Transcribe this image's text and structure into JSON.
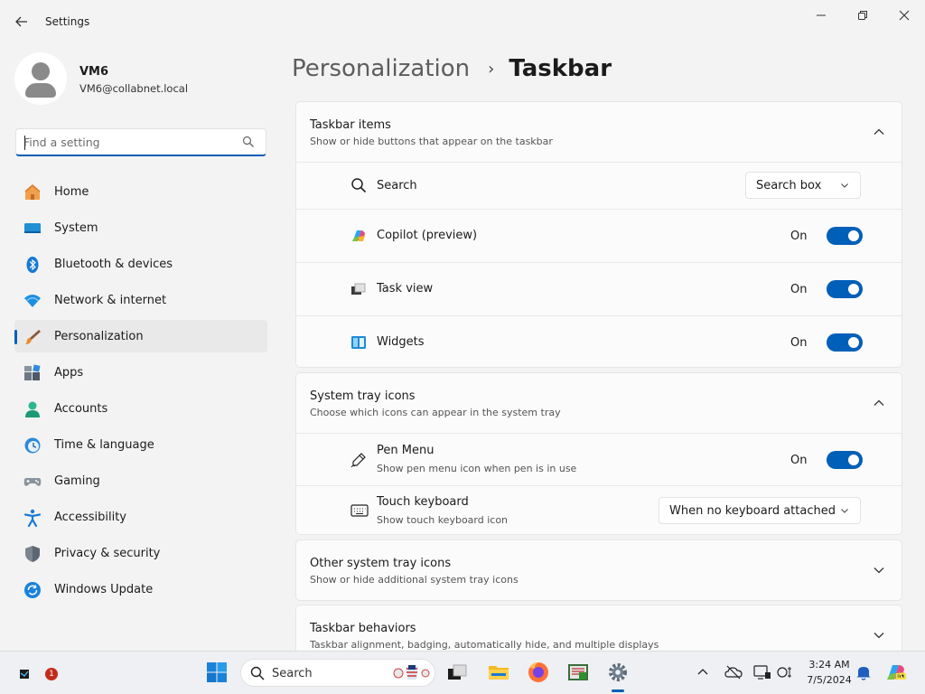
{
  "window": {
    "title": "Settings",
    "back_icon": "back-arrow-icon",
    "controls": [
      "minimize-icon",
      "restore-icon",
      "close-icon"
    ]
  },
  "profile": {
    "name": "VM6",
    "email": "VM6@collabnet.local"
  },
  "search": {
    "placeholder": "Find a setting",
    "value": ""
  },
  "sidebar": {
    "items": [
      {
        "label": "Home",
        "icon": "home-icon",
        "active": false
      },
      {
        "label": "System",
        "icon": "system-icon",
        "active": false
      },
      {
        "label": "Bluetooth & devices",
        "icon": "bluetooth-icon",
        "active": false
      },
      {
        "label": "Network & internet",
        "icon": "network-icon",
        "active": false
      },
      {
        "label": "Personalization",
        "icon": "brush-icon",
        "active": true
      },
      {
        "label": "Apps",
        "icon": "apps-icon",
        "active": false
      },
      {
        "label": "Accounts",
        "icon": "accounts-icon",
        "active": false
      },
      {
        "label": "Time & language",
        "icon": "clock-globe-icon",
        "active": false
      },
      {
        "label": "Gaming",
        "icon": "gamepad-icon",
        "active": false
      },
      {
        "label": "Accessibility",
        "icon": "accessibility-icon",
        "active": false
      },
      {
        "label": "Privacy & security",
        "icon": "shield-icon",
        "active": false
      },
      {
        "label": "Windows Update",
        "icon": "update-icon",
        "active": false
      }
    ]
  },
  "breadcrumb": {
    "parent": "Personalization",
    "separator": "›",
    "current": "Taskbar"
  },
  "sections": {
    "taskbar_items": {
      "title": "Taskbar items",
      "description": "Show or hide buttons that appear on the taskbar",
      "expanded": true,
      "rows": {
        "search": {
          "label": "Search",
          "value": "Search box"
        },
        "copilot": {
          "label": "Copilot (preview)",
          "state": "On"
        },
        "task_view": {
          "label": "Task view",
          "state": "On"
        },
        "widgets": {
          "label": "Widgets",
          "state": "On"
        }
      }
    },
    "system_tray": {
      "title": "System tray icons",
      "description": "Choose which icons can appear in the system tray",
      "expanded": true,
      "rows": {
        "pen_menu": {
          "label": "Pen Menu",
          "sub": "Show pen menu icon when pen is in use",
          "state": "On"
        },
        "touch_keyboard": {
          "label": "Touch keyboard",
          "sub": "Show touch keyboard icon",
          "value": "When no keyboard attached"
        }
      }
    },
    "other_tray": {
      "title": "Other system tray icons",
      "description": "Show or hide additional system tray icons",
      "expanded": false
    },
    "behaviors": {
      "title": "Taskbar behaviors",
      "description": "Taskbar alignment, badging, automatically hide, and multiple displays",
      "expanded": false
    }
  },
  "taskbar": {
    "search_label": "Search",
    "notification_count": "1",
    "time": "3:24 AM",
    "date": "7/5/2024",
    "pinned": [
      "start-icon",
      "search-icon",
      "task-view-icon",
      "file-explorer-icon",
      "firefox-icon",
      "app-icon",
      "settings-icon"
    ],
    "tray": [
      "chevron-up-icon",
      "onedrive-icon",
      "network-icon",
      "power-icon",
      "notification-bell-icon",
      "copilot-icon"
    ]
  },
  "colors": {
    "accent": "#005fb8",
    "background": "#f3f3f3",
    "card": "#fbfbfb"
  }
}
